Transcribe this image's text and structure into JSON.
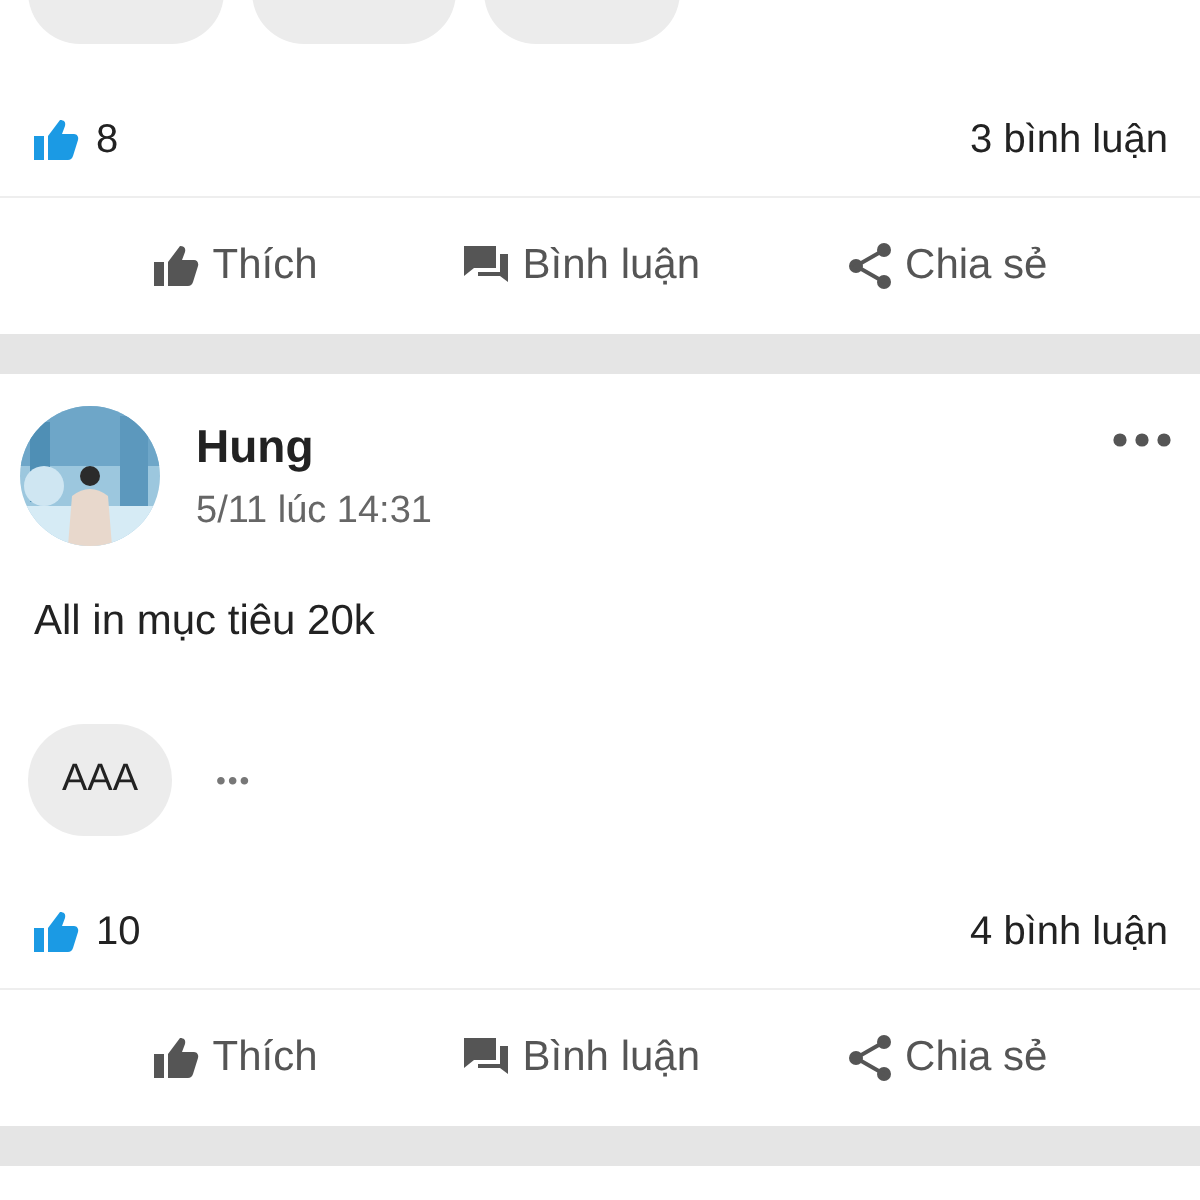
{
  "posts": [
    {
      "tags": [
        {
          "kind": "cut"
        },
        {
          "kind": "cut"
        },
        {
          "kind": "cut"
        }
      ],
      "likes": "8",
      "comments": "3 bình luận",
      "actions": [
        "Thích",
        "Bình luận",
        "Chia sẻ"
      ]
    },
    {
      "author": "Hung",
      "time": "5/11 lúc 14:31",
      "body": "All in mục tiêu 20k",
      "tags": [
        {
          "kind": "text",
          "label": "AAA"
        },
        {
          "kind": "more",
          "label": "•••"
        }
      ],
      "likes": "10",
      "comments": "4 bình luận",
      "actions": [
        "Thích",
        "Bình luận",
        "Chia sẻ"
      ]
    }
  ]
}
